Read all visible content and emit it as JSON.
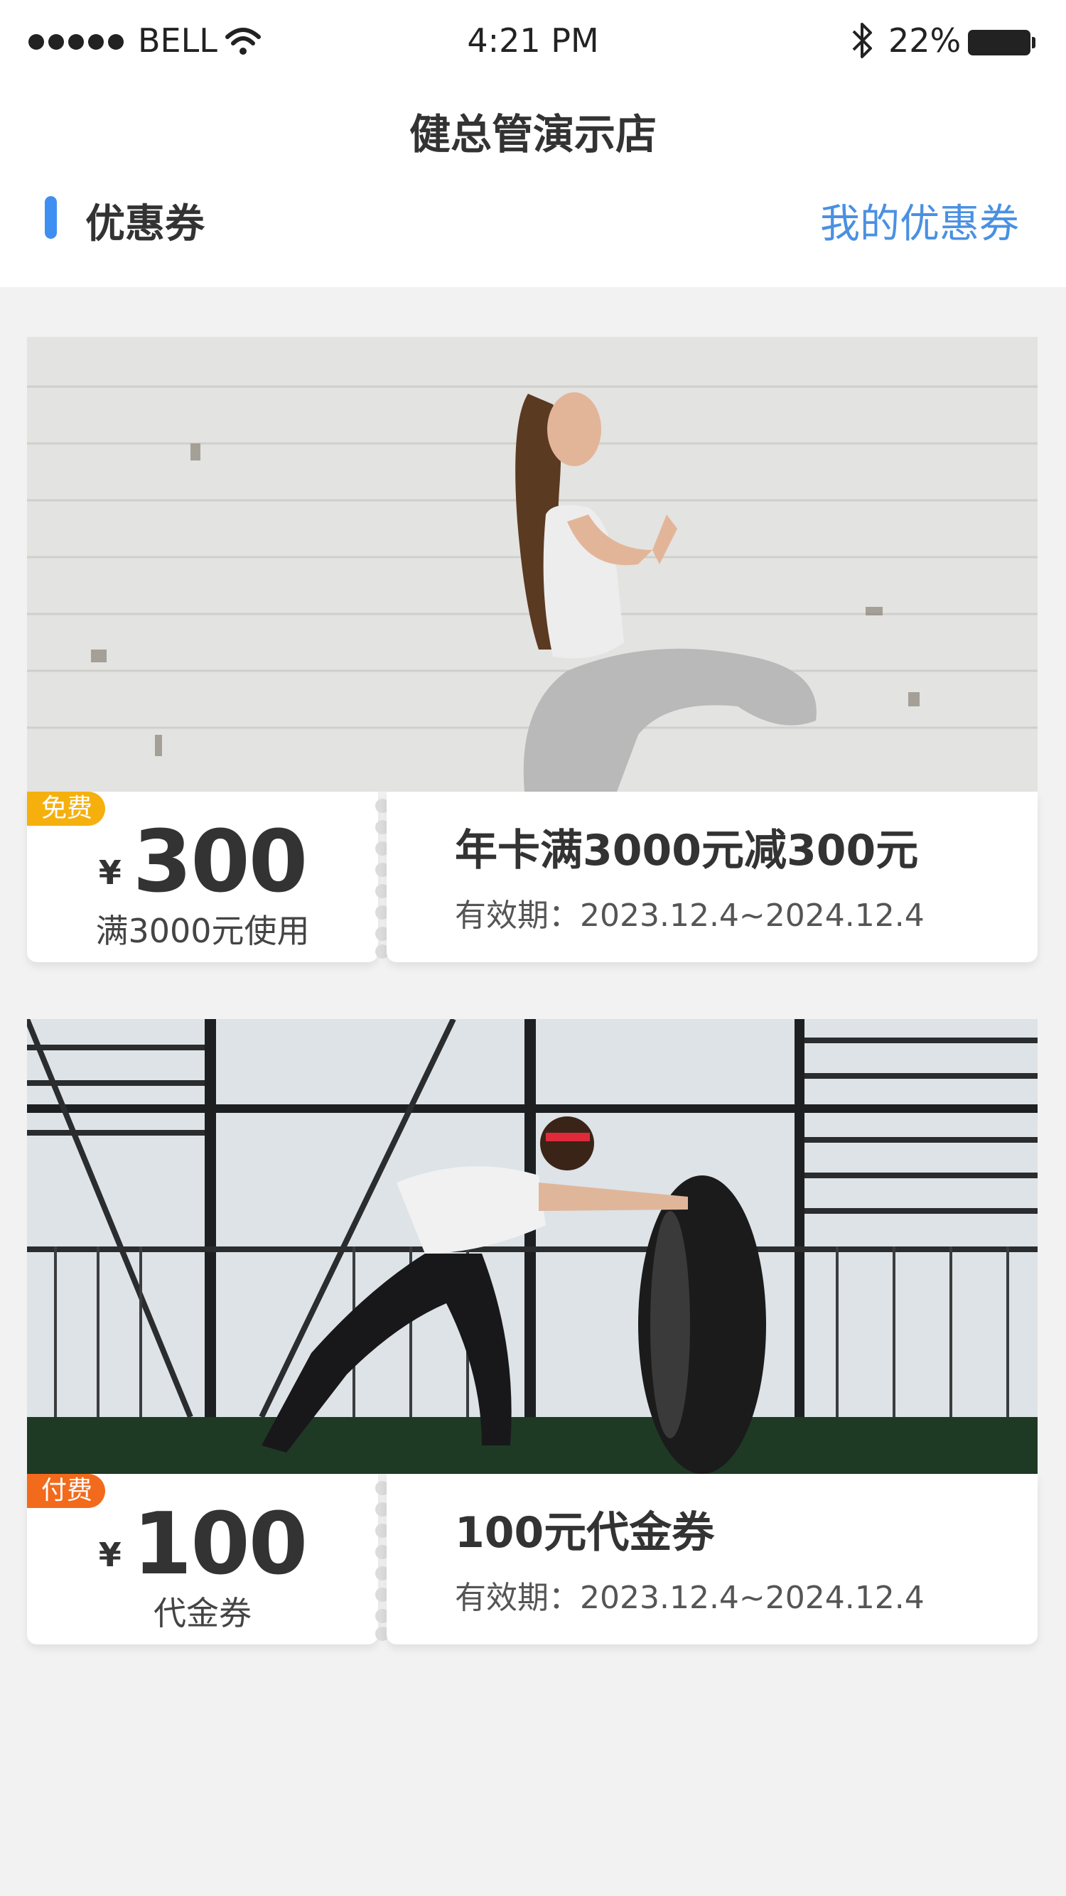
{
  "status_bar": {
    "carrier": "BELL",
    "time": "4:21 PM",
    "battery": "22%",
    "battery_level": 0.22
  },
  "header": {
    "title": "健总管演示店"
  },
  "section": {
    "title": "优惠券",
    "link": "我的优惠券"
  },
  "accent_color": "#3f8ff2",
  "coupons": [
    {
      "tag": "免费",
      "tag_color": "#f5b00e",
      "currency": "¥",
      "amount": "300",
      "condition": "满3000元使用",
      "title": "年卡满3000元减300元",
      "validity": "有效期：2023.12.4~2024.12.4"
    },
    {
      "tag": "付费",
      "tag_color": "#f26a1b",
      "currency": "¥",
      "amount": "100",
      "condition": "代金券",
      "title": "100元代金券",
      "validity": "有效期：2023.12.4~2024.12.4"
    }
  ]
}
